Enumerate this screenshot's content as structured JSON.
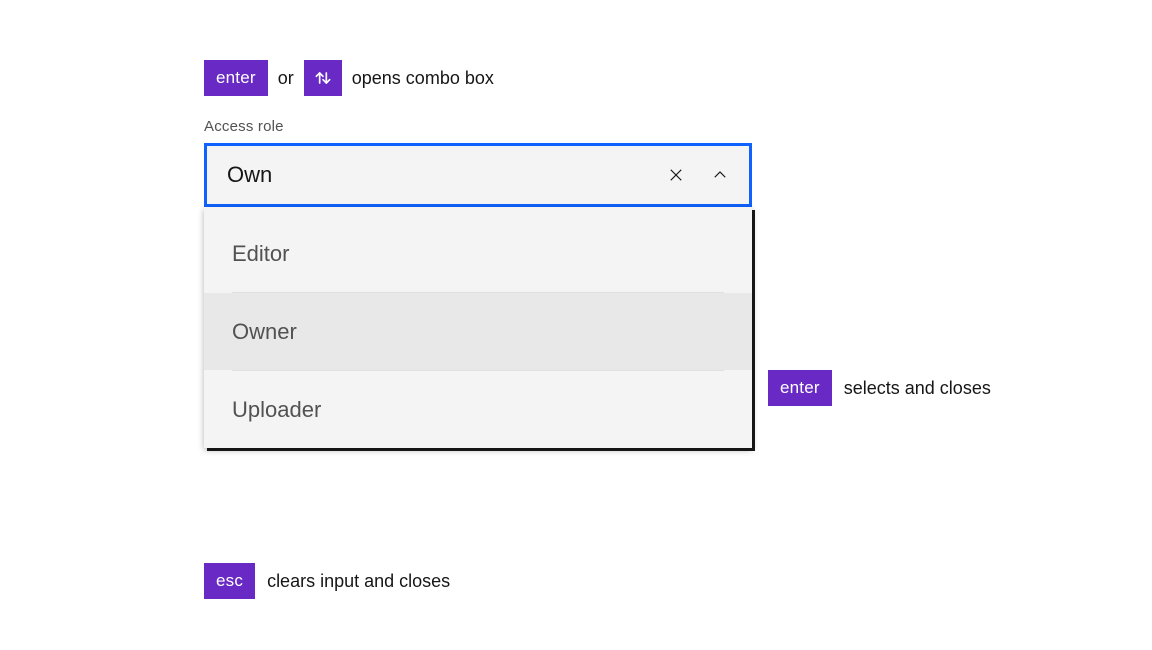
{
  "colors": {
    "key_badge_bg": "#6929c4",
    "key_badge_fg": "#ffffff",
    "focus_border": "#0f62fe",
    "field_bg": "#f4f4f4",
    "highlight_bg": "#e8e8e8",
    "text_primary": "#161616",
    "text_secondary": "#525252"
  },
  "top_hint": {
    "key1": "enter",
    "or": "or",
    "key2_icon": "arrows-up-down-icon",
    "text": "opens combo box"
  },
  "field": {
    "label": "Access role",
    "value": "Own",
    "clear_icon": "close-icon",
    "toggle_icon": "chevron-up-icon"
  },
  "options": [
    {
      "label": "Editor",
      "highlighted": false
    },
    {
      "label": "Owner",
      "highlighted": true
    },
    {
      "label": "Uploader",
      "highlighted": false
    }
  ],
  "select_hint": {
    "key": "enter",
    "text": "selects and closes"
  },
  "esc_hint": {
    "key": "esc",
    "text": "clears input and closes"
  }
}
